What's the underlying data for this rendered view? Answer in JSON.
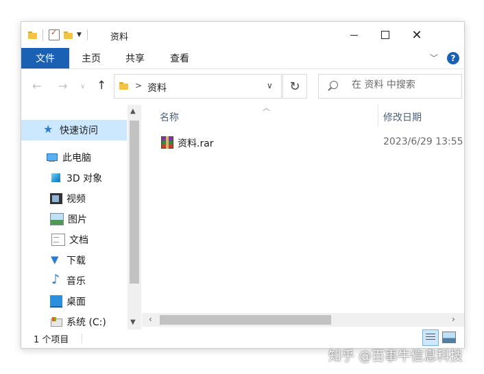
{
  "window": {
    "title": "资料"
  },
  "ribbon": {
    "tabs": {
      "file": "文件",
      "home": "主页",
      "share": "共享",
      "view": "查看"
    },
    "help": "?"
  },
  "address": {
    "crumb": "资料",
    "separator": ">"
  },
  "search": {
    "placeholder": "在 资料 中搜索"
  },
  "nav": {
    "items": [
      {
        "label": "快速访问"
      },
      {
        "label": "此电脑"
      },
      {
        "label": "3D 对象"
      },
      {
        "label": "视频"
      },
      {
        "label": "图片"
      },
      {
        "label": "文档"
      },
      {
        "label": "下载"
      },
      {
        "label": "音乐"
      },
      {
        "label": "桌面"
      },
      {
        "label": "系统 (C:)"
      }
    ]
  },
  "columns": {
    "name": "名称",
    "date": "修改日期"
  },
  "files": [
    {
      "name": "资料.rar",
      "date": "2023/6/29 13:55"
    }
  ],
  "status": {
    "count": "1 个项目"
  },
  "watermark": "知乎 @百事牛信息科技",
  "colors": {
    "accent": "#1a61b4",
    "selection": "#cce8ff"
  }
}
